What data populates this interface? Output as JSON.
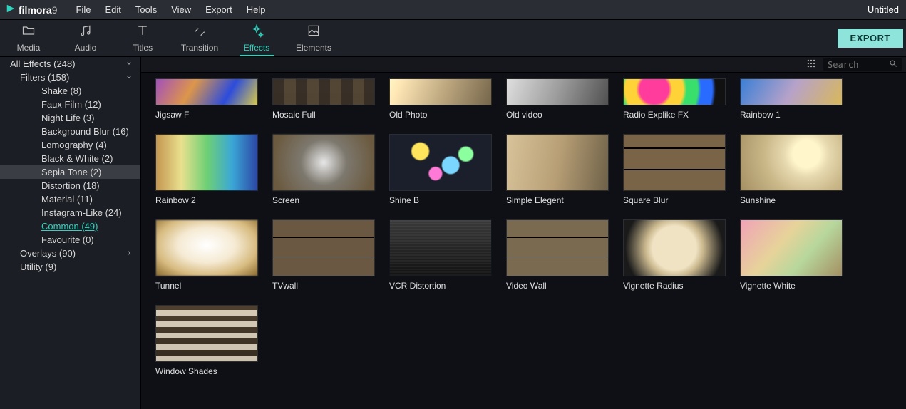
{
  "app": {
    "logo_text": "filmora",
    "logo_suffix": "9"
  },
  "menubar": [
    "File",
    "Edit",
    "Tools",
    "View",
    "Export",
    "Help"
  ],
  "project_title": "Untitled",
  "toolbar": {
    "tabs": [
      {
        "label": "Media"
      },
      {
        "label": "Audio"
      },
      {
        "label": "Titles"
      },
      {
        "label": "Transition"
      },
      {
        "label": "Effects"
      },
      {
        "label": "Elements"
      }
    ],
    "export_label": "EXPORT"
  },
  "search": {
    "placeholder": "Search"
  },
  "sidebar": {
    "items": [
      {
        "label": "All Effects (248)",
        "level": 0,
        "expand": "down"
      },
      {
        "label": "Filters (158)",
        "level": 1,
        "expand": "down"
      },
      {
        "label": "Shake (8)",
        "level": 2
      },
      {
        "label": "Faux Film (12)",
        "level": 2
      },
      {
        "label": "Night Life (3)",
        "level": 2
      },
      {
        "label": "Background Blur (16)",
        "level": 2
      },
      {
        "label": "Lomography (4)",
        "level": 2
      },
      {
        "label": "Black & White (2)",
        "level": 2
      },
      {
        "label": "Sepia Tone (2)",
        "level": 2,
        "selected": true
      },
      {
        "label": "Distortion (18)",
        "level": 2
      },
      {
        "label": "Material (11)",
        "level": 2
      },
      {
        "label": "Instagram-Like (24)",
        "level": 2
      },
      {
        "label": "Common (49)",
        "level": 2,
        "accent": true
      },
      {
        "label": "Favourite (0)",
        "level": 2
      },
      {
        "label": "Overlays (90)",
        "level": 1,
        "expand": "right"
      },
      {
        "label": "Utility (9)",
        "level": 1
      }
    ]
  },
  "effects": [
    {
      "label": "Jigsaw F",
      "bg": "bg0",
      "short": true
    },
    {
      "label": "Mosaic Full",
      "bg": "bg1",
      "short": true
    },
    {
      "label": "Old Photo",
      "bg": "bg2",
      "short": true
    },
    {
      "label": "Old video",
      "bg": "bg3",
      "short": true
    },
    {
      "label": "Radio Explike FX",
      "bg": "bg4",
      "short": true
    },
    {
      "label": "Rainbow 1",
      "bg": "bg5",
      "short": true
    },
    {
      "label": "Rainbow 2",
      "bg": "bg6"
    },
    {
      "label": "Screen",
      "bg": "bg7"
    },
    {
      "label": "Shine B",
      "bg": "bg8"
    },
    {
      "label": "Simple Elegent",
      "bg": "bg9"
    },
    {
      "label": "Square Blur",
      "bg": "bg10"
    },
    {
      "label": "Sunshine",
      "bg": "bg11"
    },
    {
      "label": "Tunnel",
      "bg": "bg12"
    },
    {
      "label": "TVwall",
      "bg": "bg13"
    },
    {
      "label": "VCR Distortion",
      "bg": "bg14"
    },
    {
      "label": "Video Wall",
      "bg": "bg15"
    },
    {
      "label": "Vignette Radius",
      "bg": "bg16"
    },
    {
      "label": "Vignette White",
      "bg": "bg17"
    },
    {
      "label": "Window Shades",
      "bg": "bg18"
    }
  ]
}
